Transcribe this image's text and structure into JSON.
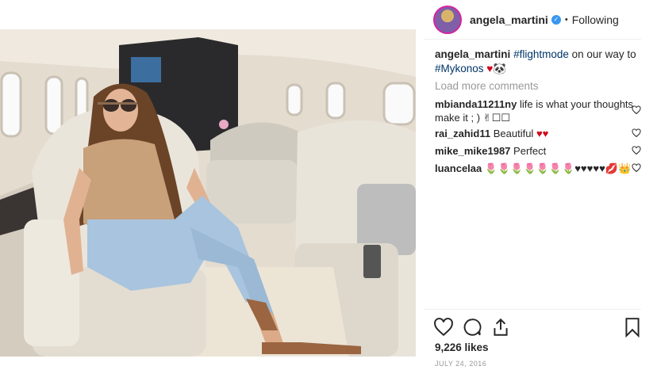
{
  "post": {
    "username": "angela_martini",
    "dot": "•",
    "follow_status": "Following",
    "caption": {
      "username": "angela_martini",
      "tag1": "#flightmode",
      "text_mid": " on our way to ",
      "tag2": "#Mykonos",
      "emoji": " ♥🐼"
    },
    "load_more": "Load more comments",
    "comments": [
      {
        "user": "mbianda11211ny",
        "text": "life is what your thoughts make it ; ) ✌☐☐"
      },
      {
        "user": "rai_zahid11",
        "text": "Beautiful ",
        "emoji": "♥♥"
      },
      {
        "user": "mike_mike1987",
        "text": "Perfect"
      },
      {
        "user": "luancelaa",
        "text": "🌷🌷🌷🌷🌷🌷🌷♥♥♥♥♥💋👑"
      }
    ],
    "likes": "9,226 likes",
    "date": "JULY 24, 2016"
  },
  "icons": {
    "verified": "verified-badge-icon",
    "like": "heart-icon",
    "comment": "comment-bubble-icon",
    "share": "share-icon",
    "save": "bookmark-icon"
  },
  "colors": {
    "text": "#262626",
    "muted": "#999999",
    "hashtag": "#003569",
    "verified": "#3897f0",
    "red_heart": "#d0021b"
  }
}
